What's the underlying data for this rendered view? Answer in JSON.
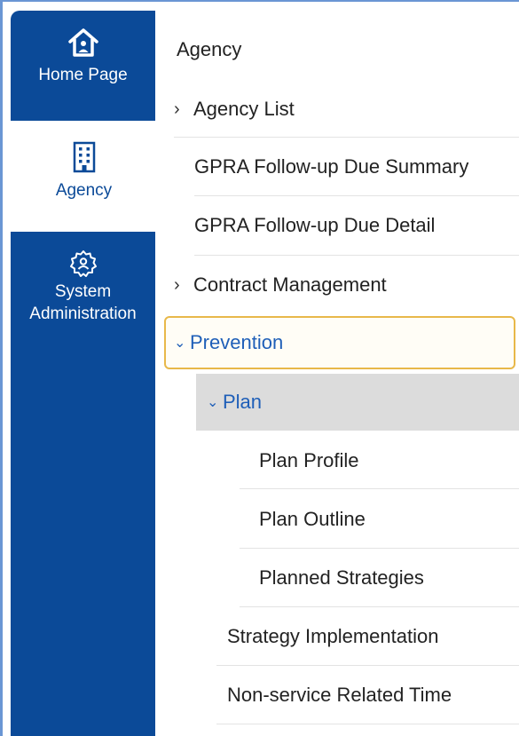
{
  "sidebar": {
    "items": [
      {
        "label": "Home Page",
        "icon": "home-icon",
        "active": false
      },
      {
        "label": "Agency",
        "icon": "building-icon",
        "active": true
      },
      {
        "label": "System\nAdministration",
        "icon": "gear-icon",
        "active": false
      }
    ],
    "colors": {
      "background": "#0b4a98",
      "active_background": "#ffffff"
    }
  },
  "menu": {
    "title": "Agency",
    "items": [
      {
        "label": "Agency List",
        "expandable": true,
        "expanded": false
      },
      {
        "label": "GPRA Follow-up Due Summary"
      },
      {
        "label": "GPRA Follow-up Due Detail"
      },
      {
        "label": "Contract Management",
        "expandable": true,
        "expanded": false
      },
      {
        "label": "Prevention",
        "expandable": true,
        "expanded": true,
        "focused": true
      },
      {
        "label": "Plan",
        "expandable": true,
        "expanded": true,
        "selected": true
      },
      {
        "label": "Plan Profile"
      },
      {
        "label": "Plan Outline"
      },
      {
        "label": "Planned Strategies"
      },
      {
        "label": "Strategy Implementation"
      },
      {
        "label": "Non-service Related Time"
      }
    ],
    "colors": {
      "accent": "#1f5fb8",
      "focus_border": "#e8b84a",
      "selected_background": "#dcdcdc"
    }
  }
}
